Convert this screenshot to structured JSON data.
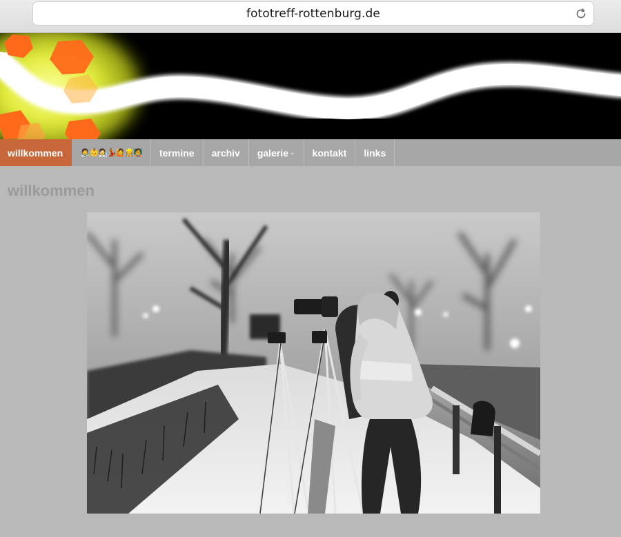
{
  "browser": {
    "url": "fototreff-rottenburg.de",
    "reload_icon": "reload-icon"
  },
  "nav": {
    "items": [
      {
        "label": "willkommen",
        "active": true
      },
      {
        "label": "🧑‍🎨👶🧑‍🔬💃🙋👷🧑‍🏫",
        "active": false
      },
      {
        "label": "termine",
        "active": false
      },
      {
        "label": "archiv",
        "active": false
      },
      {
        "label": "galerie",
        "active": false,
        "dropdown_icon": "chevron-down-icon"
      },
      {
        "label": "kontakt",
        "active": false
      },
      {
        "label": "links",
        "active": false
      }
    ],
    "caret": "⌄"
  },
  "page": {
    "title": "willkommen"
  },
  "colors": {
    "accent": "#c8683a",
    "nav_bg": "#a7a7a7",
    "page_bg": "#b9b9b9",
    "title": "#9a9a9a"
  }
}
